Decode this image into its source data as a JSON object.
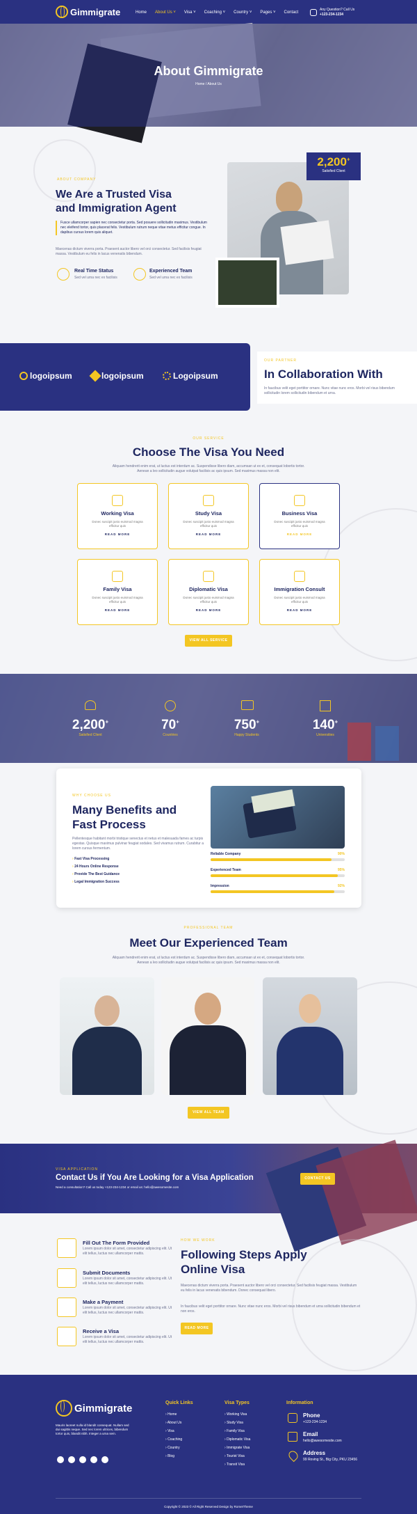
{
  "nav": {
    "brand": "Gimmigrate",
    "items": [
      "Home",
      "About Us ˅",
      "Visa ˅",
      "Coaching ˅",
      "Country ˅",
      "Pages ˅",
      "Contact"
    ],
    "call_label": "Any Question? Call Us",
    "phone": "+123-234-1234"
  },
  "hero": {
    "title": "About Gimmigrate",
    "breadcrumb": "Home / About Us"
  },
  "about": {
    "tag": "About Company",
    "title_line1": "We Are a Trusted Visa",
    "title_line2": "and Immigration Agent",
    "quote": "Fusce ullamcorper sapien nec consectetur porta. Sed posuere sollicitudin maximus. Vestibulum nec eleifend tortor, quis placerat felis. Vestibulum rutrum neque vitae metus efficitur congue. In dapibus cursus lorem quis aliquet.",
    "para": "Maecenas dictum viverra porta. Praesent auctor libero vel orci consectetur. Sed facilisis feugiat massa. Vestibulum eu felis in lacus venenatis bibendum.",
    "feature1_title": "Real Time Status",
    "feature1_text": "Sed vel urna nec ex facilisis",
    "feature2_title": "Experienced Team",
    "feature2_text": "Sed vel urna nec ex facilisis",
    "badge_num": "2,200",
    "badge_sup": "+",
    "badge_label": "Satisfied Client"
  },
  "partner": {
    "logos": [
      "logoipsum",
      "logoipsum",
      "Logoipsum"
    ],
    "tag": "Our Partner",
    "title": "In Collaboration With",
    "text": "In faucibus velit eget porttitor ornare. Nunc vitae nunc eros. Morbi vel risus bibendum sollicitudin lorem sollicitudin bibendum et urna."
  },
  "services": {
    "tag": "Our Service",
    "title": "Choose The Visa You Need",
    "intro": "Aliquam hendrerit enim erat, ut luctus est interdum ac. Suspendisse libero diam, accumsan ut ex et, consequat lobortis tortor. Aenean a leo sollicitudin augue volutpat facilisis ac quis ipsum. Sed maximus massa non elit.",
    "cards": [
      {
        "title": "Working Visa",
        "desc": "Donec suscipit justo euismod magna efficitur quis",
        "more": "READ MORE"
      },
      {
        "title": "Study Visa",
        "desc": "Donec suscipit justo euismod magna efficitur quis",
        "more": "READ MORE"
      },
      {
        "title": "Business Visa",
        "desc": "Donec suscipit justo euismod magna efficitur quis",
        "more": "READ MORE"
      },
      {
        "title": "Family Visa",
        "desc": "Donec suscipit justo euismod magna efficitur quis",
        "more": "READ MORE"
      },
      {
        "title": "Diplomatic Visa",
        "desc": "Donec suscipit justo euismod magna efficitur quis",
        "more": "READ MORE"
      },
      {
        "title": "Immigration Consult",
        "desc": "Donec suscipit justo euismod magna efficitur quis",
        "more": "READ MORE"
      }
    ],
    "button": "VIEW ALL SERVICE"
  },
  "stats": [
    {
      "num": "2,200",
      "sup": "+",
      "label": "Satisfied Client"
    },
    {
      "num": "70",
      "sup": "+",
      "label": "Countries"
    },
    {
      "num": "750",
      "sup": "+",
      "label": "Happy Students"
    },
    {
      "num": "140",
      "sup": "+",
      "label": "Universities"
    }
  ],
  "benefits": {
    "tag": "Why Choose Us",
    "title_line1": "Many Benefits and",
    "title_line2": "Fast Process",
    "text": "Pellentesque habitant morbi tristique senectus et netus et malesuada fames ac turpis egestas. Quisque maximus pulvinar feugiat sodales. Sed vivamus rutrum. Curabitur a lorem cursus fermentum.",
    "list": [
      "Fast Visa Processing",
      "24 Hours Online Response",
      "Provide The Best Guidance",
      "Legal Immigration Success"
    ],
    "bars": [
      {
        "label": "Reliable Company",
        "value": 90,
        "text": "90%"
      },
      {
        "label": "Experienced Team",
        "value": 95,
        "text": "95%"
      },
      {
        "label": "Impression",
        "value": 92,
        "text": "92%"
      }
    ]
  },
  "team": {
    "tag": "Professional Team",
    "title": "Meet Our Experienced Team",
    "intro": "Aliquam hendrerit enim erat, ut luctus est interdum ac. Suspendisse libero diam, accumsan ut ex et, consequat lobortis tortor. Aenean a leo sollicitudin augue volutpat facilisis ac quis ipsum. Sed maximus massa non elit.",
    "button": "VIEW ALL TEAM"
  },
  "contact_banner": {
    "tag": "Visa Application",
    "title": "Contact Us if You Are Looking for a Visa Application",
    "text": "Need a consultation? Call us today +123-234-1234 or email us: hello@awesomesite.com",
    "button": "CONTACT US"
  },
  "steps": {
    "tag": "How We Work",
    "title_line1": "Following Steps Apply",
    "title_line2": "Online Visa",
    "items": [
      {
        "title": "Fill Out The Form Provided",
        "text": "Lorem ipsum dolor sit amet, consectetur adipiscing elit. Ut elit tellus, luctus nec ullamcorper mattis."
      },
      {
        "title": "Submit Documents",
        "text": "Lorem ipsum dolor sit amet, consectetur adipiscing elit. Ut elit tellus, luctus nec ullamcorper mattis."
      },
      {
        "title": "Make a Payment",
        "text": "Lorem ipsum dolor sit amet, consectetur adipiscing elit. Ut elit tellus, luctus nec ullamcorper mattis."
      },
      {
        "title": "Receive a Visa",
        "text": "Lorem ipsum dolor sit amet, consectetur adipiscing elit. Ut elit tellus, luctus nec ullamcorper mattis."
      }
    ],
    "para1": "Maecenas dictum viverra porta. Praesent auctor libero vel orci consectetur. Sed facilisis feugiat massa. Vestibulum eu felis in lacus venenatis bibendum. Donec consequat libero.",
    "para2": "In faucibus velit eget porttitor ornare. Nunc vitae nunc eros. Morbi vel risus bibendum et urna sollicitudin bibendum et non eros.",
    "button": "READ MORE"
  },
  "footer": {
    "brand": "Gimmigrate",
    "about": "Mauris laoreet nulla id blandit consequat. Nullam sed dui sagittis neque. Sed nec lorem ultrices, bibendum tortor quis, blandit nibh. Integer a urna sem.",
    "quick_title": "Quick Links",
    "quick": [
      "Home",
      "About Us",
      "Visa",
      "Coaching",
      "Country",
      "Blog"
    ],
    "visa_title": "Visa Types",
    "visa": [
      "Working Visa",
      "Study Visa",
      "Family Visa",
      "Diplomatic Visa",
      "Immigrate Visa",
      "Tourist Visa",
      "Transit Visa"
    ],
    "info_title": "Information",
    "phone_label": "Phone",
    "phone": "+123-234-1234",
    "email_label": "Email",
    "email": "hello@awesomesite.com",
    "address_label": "Address",
    "address": "99 Roving St., Big City, PKU 23456",
    "copyright": "Copyright © 2023 © All Right Reserved Design by RometTheme"
  }
}
